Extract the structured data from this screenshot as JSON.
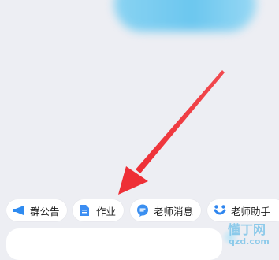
{
  "quick_actions": [
    {
      "label": "群公告",
      "icon": "megaphone-icon",
      "color": "#2f8bf0"
    },
    {
      "label": "作业",
      "icon": "document-icon",
      "color": "#3b8df2"
    },
    {
      "label": "老师消息",
      "icon": "chat-bubble-icon",
      "color": "#3a8ff0"
    },
    {
      "label": "老师助手",
      "icon": "assistant-icon",
      "color": "#2f86ef"
    }
  ],
  "annotation": {
    "color": "#f0333a",
    "icon": "red-arrow-icon"
  },
  "watermark": {
    "text": "懂丁网",
    "url": "qzd.com"
  },
  "colors": {
    "background": "#edeef3",
    "accent_blob": "#5ec3ef"
  }
}
